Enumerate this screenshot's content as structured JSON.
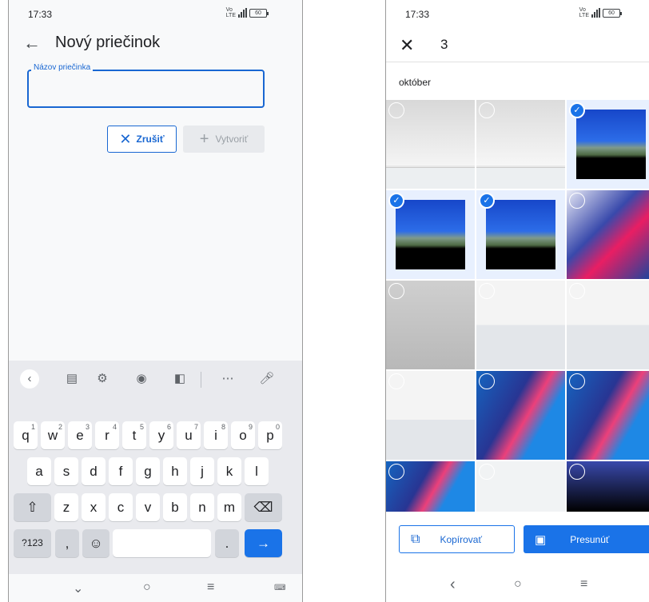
{
  "left": {
    "status": {
      "time": "17:33",
      "network": "LTE",
      "battery": "60"
    },
    "header": {
      "title": "Nový priečinok"
    },
    "form": {
      "field_label": "Názov priečinka",
      "field_value": ""
    },
    "buttons": {
      "cancel": "Zrušiť",
      "create": "Vytvoriť"
    },
    "keyboard": {
      "row1": [
        [
          "q",
          "1"
        ],
        [
          "w",
          "2"
        ],
        [
          "e",
          "3"
        ],
        [
          "r",
          "4"
        ],
        [
          "t",
          "5"
        ],
        [
          "y",
          "6"
        ],
        [
          "u",
          "7"
        ],
        [
          "i",
          "8"
        ],
        [
          "o",
          "9"
        ],
        [
          "p",
          "0"
        ]
      ],
      "row2": [
        "a",
        "s",
        "d",
        "f",
        "g",
        "h",
        "j",
        "k",
        "l"
      ],
      "row3": [
        "z",
        "x",
        "c",
        "v",
        "b",
        "n",
        "m"
      ],
      "symbols": "?123",
      "comma": ",",
      "period": "."
    }
  },
  "right": {
    "status": {
      "time": "17:33",
      "network": "LTE",
      "battery": "60"
    },
    "header": {
      "selected_count": "3"
    },
    "section_label": "október",
    "actions": {
      "copy": "Kopírovať",
      "move": "Presunúť"
    }
  },
  "colors": {
    "accent": "#1a73e8"
  }
}
